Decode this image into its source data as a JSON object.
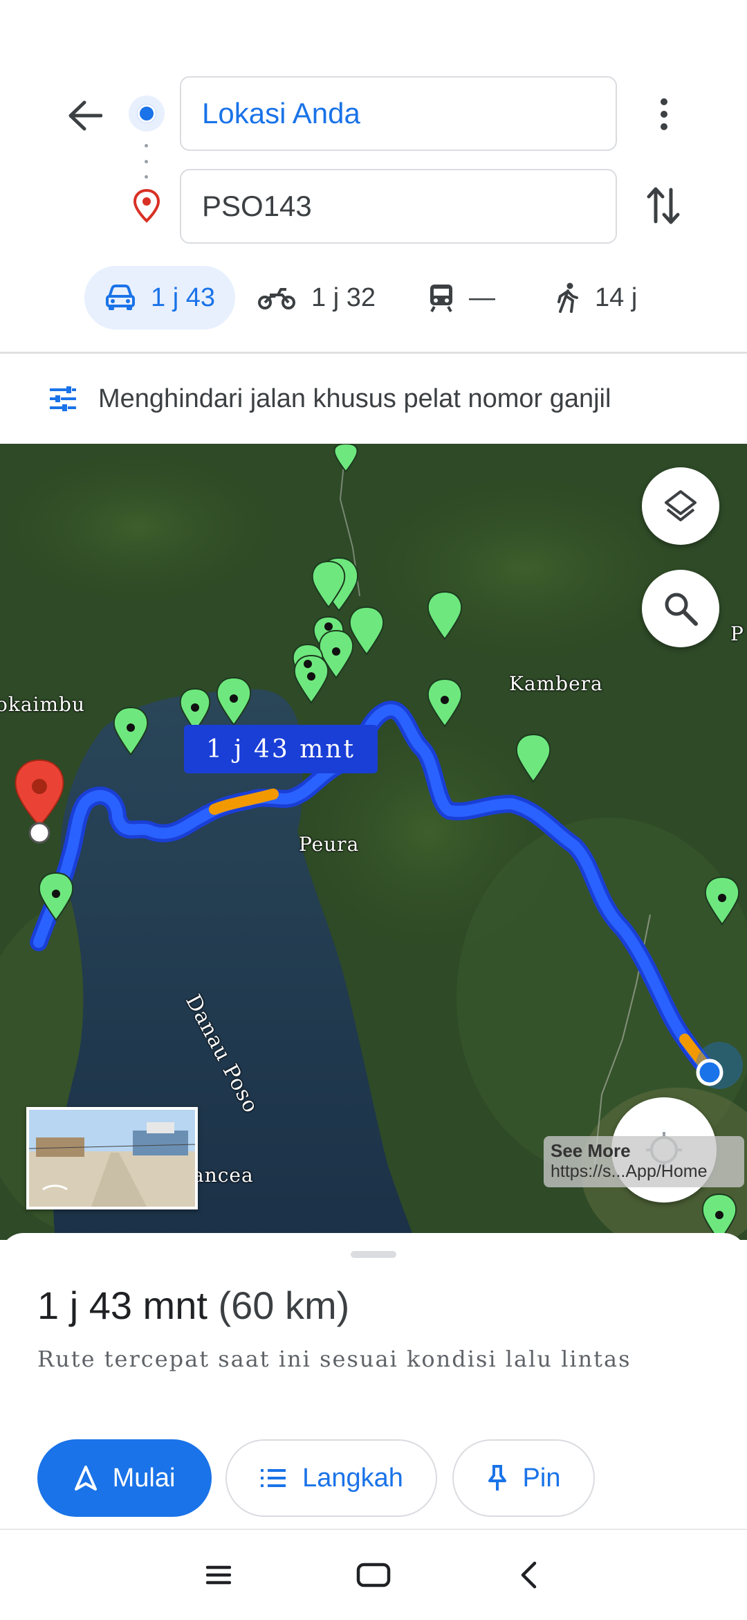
{
  "search": {
    "origin": "Lokasi Anda",
    "destination": "PSO143"
  },
  "modes": [
    {
      "name": "car",
      "label": "1 j 43",
      "selected": true
    },
    {
      "name": "motorcycle",
      "label": "1 j 32"
    },
    {
      "name": "transit",
      "label": "—"
    },
    {
      "name": "walk",
      "label": "14 j"
    }
  ],
  "options": {
    "label": "Menghindari jalan khusus pelat nomor ganjil"
  },
  "map": {
    "labels": {
      "mokaimbu": "okaimbu",
      "kambera": "Kambera",
      "peura": "Peura",
      "danau": "Danau Poso",
      "pancea": "ancea",
      "p": "P"
    },
    "route_badge": "1 j 43 mnt",
    "see_more": {
      "title": "See More",
      "url": "https://s...App/Home"
    }
  },
  "sheet": {
    "duration": "1 j 43 mnt",
    "distance": "(60 km)",
    "subtitle": "Rute tercepat saat ini sesuai kondisi lalu lintas",
    "buttons": {
      "start": "Mulai",
      "steps": "Langkah",
      "pin": "Pin"
    }
  },
  "colors": {
    "accent": "#1a73e8",
    "route": "#1a3fd6",
    "traffic": "#f29900",
    "destination_pin": "#d93025"
  }
}
